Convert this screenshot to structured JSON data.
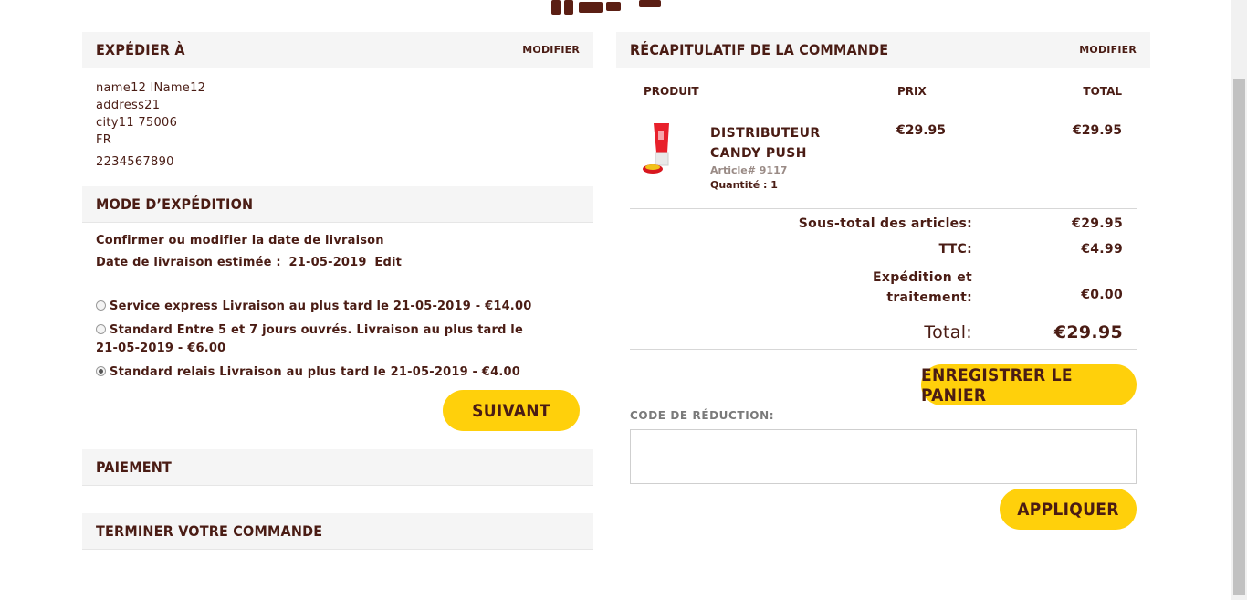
{
  "shipping_to": {
    "title": "EXPÉDIER À",
    "edit_label": "MODIFIER",
    "name": "name12 lName12",
    "address": "address21",
    "city_line": "city11 75006",
    "country": "FR",
    "phone": "2234567890"
  },
  "shipping_method": {
    "title": "MODE D’EXPÉDITION",
    "confirm_text": "Confirmer ou modifier la date de livraison",
    "estimate_label": "Date de livraison estimée :",
    "estimate_date": "21-05-2019",
    "edit_label": "Edit",
    "options": [
      {
        "label": "Service express Livraison au plus tard le 21-05-2019 - €14.00",
        "selected": false
      },
      {
        "label": "Standard Entre 5 et 7 jours ouvrés. Livraison au plus tard le 21-05-2019 - €6.00",
        "selected": false
      },
      {
        "label": "Standard relais Livraison au plus tard le 21-05-2019 - €4.00",
        "selected": true
      }
    ],
    "next_button": "SUIVANT"
  },
  "payment": {
    "title": "PAIEMENT"
  },
  "complete": {
    "title": "TERMINER VOTRE COMMANDE"
  },
  "order_summary": {
    "title": "RÉCAPITULATIF DE LA COMMANDE",
    "edit_label": "MODIFIER",
    "columns": {
      "product": "PRODUIT",
      "price": "PRIX",
      "total": "TOTAL"
    },
    "item": {
      "name_line1": "DISTRIBUTEUR",
      "name_line2": "CANDY PUSH",
      "sku": "Article# 9117",
      "qty": "Quantité : 1",
      "price": "€29.95",
      "total": "€29.95"
    },
    "subtotal_label": "Sous-total des articles:",
    "subtotal_value": "€29.95",
    "tax_label": "TTC:",
    "tax_value": "€4.99",
    "shipping_label_1": "Expédition et",
    "shipping_label_2": "traitement:",
    "shipping_value": "€0.00",
    "total_label": "Total:",
    "total_value": "€29.95",
    "save_cart_button": "ENREGISTRER LE PANIER",
    "coupon_label": "CODE DE RÉDUCTION:",
    "coupon_placeholder": "",
    "apply_button": "APPLIQUER"
  },
  "colors": {
    "accent": "#ffd00b",
    "text": "#4a1c14",
    "panel": "#f5f5f5"
  }
}
